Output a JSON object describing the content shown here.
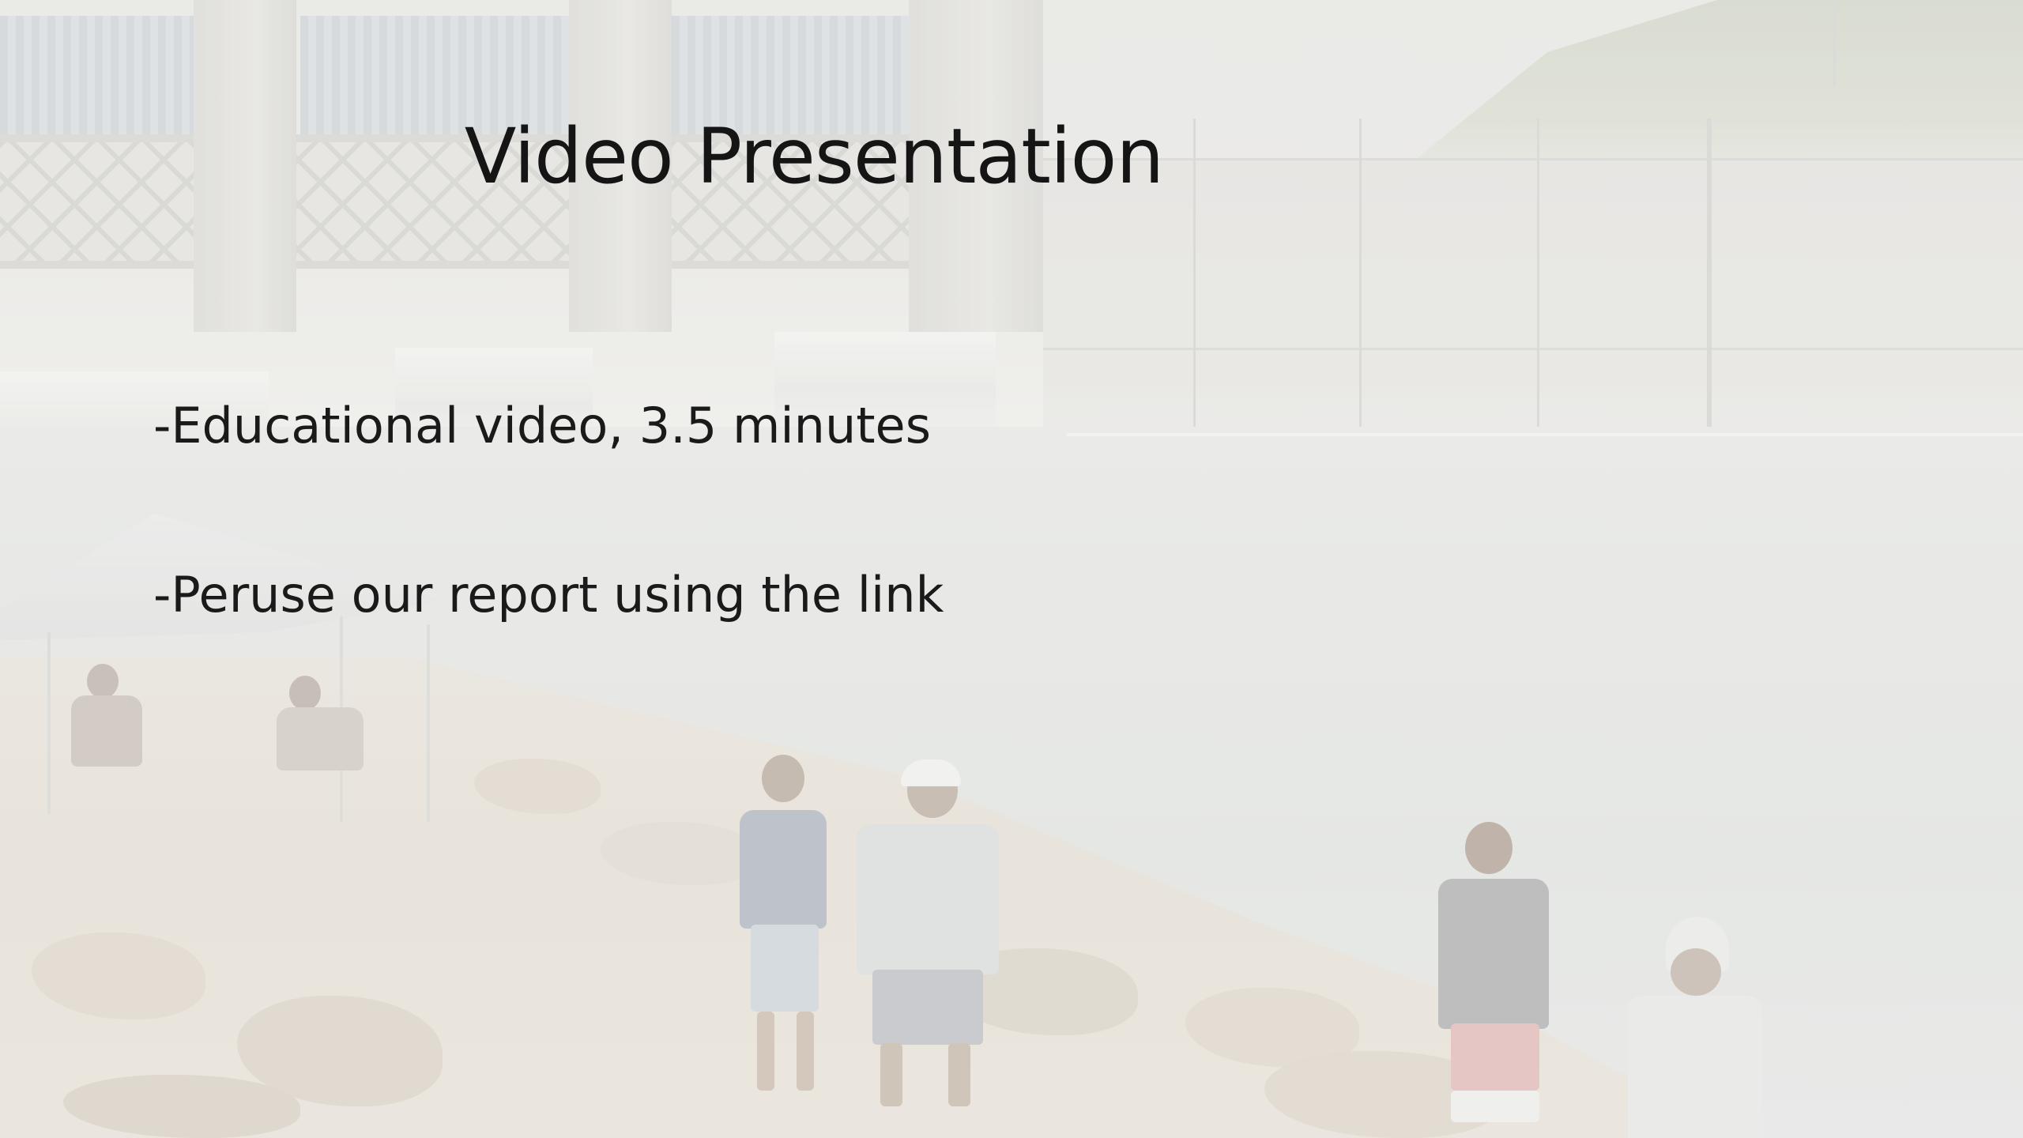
{
  "slide": {
    "title": "Video Presentation",
    "bullets": [
      "-Educational video, 3.5 minutes",
      "-Peruse our report using the link"
    ]
  },
  "colors": {
    "text": "#151515",
    "background_tint": "#ecebe6"
  }
}
